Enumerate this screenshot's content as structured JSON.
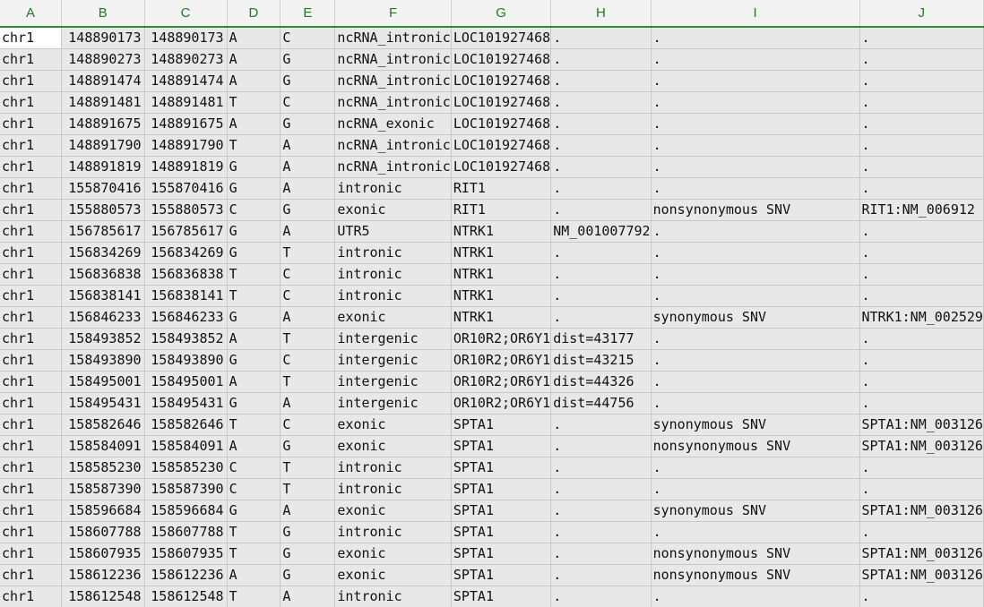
{
  "columns": [
    "A",
    "B",
    "C",
    "D",
    "E",
    "F",
    "G",
    "H",
    "I",
    "J"
  ],
  "rows": [
    [
      "chr1",
      "148890173",
      "148890173",
      "A",
      "C",
      "ncRNA_intronic",
      "LOC101927468",
      ".",
      ".",
      "."
    ],
    [
      "chr1",
      "148890273",
      "148890273",
      "A",
      "G",
      "ncRNA_intronic",
      "LOC101927468",
      ".",
      ".",
      "."
    ],
    [
      "chr1",
      "148891474",
      "148891474",
      "A",
      "G",
      "ncRNA_intronic",
      "LOC101927468",
      ".",
      ".",
      "."
    ],
    [
      "chr1",
      "148891481",
      "148891481",
      "T",
      "C",
      "ncRNA_intronic",
      "LOC101927468",
      ".",
      ".",
      "."
    ],
    [
      "chr1",
      "148891675",
      "148891675",
      "A",
      "G",
      "ncRNA_exonic",
      "LOC101927468",
      ".",
      ".",
      "."
    ],
    [
      "chr1",
      "148891790",
      "148891790",
      "T",
      "A",
      "ncRNA_intronic",
      "LOC101927468",
      ".",
      ".",
      "."
    ],
    [
      "chr1",
      "148891819",
      "148891819",
      "G",
      "A",
      "ncRNA_intronic",
      "LOC101927468",
      ".",
      ".",
      "."
    ],
    [
      "chr1",
      "155870416",
      "155870416",
      "G",
      "A",
      "intronic",
      "RIT1",
      ".",
      ".",
      "."
    ],
    [
      "chr1",
      "155880573",
      "155880573",
      "C",
      "G",
      "exonic",
      "RIT1",
      ".",
      "nonsynonymous SNV",
      "RIT1:NM_006912"
    ],
    [
      "chr1",
      "156785617",
      "156785617",
      "G",
      "A",
      "UTR5",
      "NTRK1",
      "NM_001007792",
      ".",
      "."
    ],
    [
      "chr1",
      "156834269",
      "156834269",
      "G",
      "T",
      "intronic",
      "NTRK1",
      ".",
      ".",
      "."
    ],
    [
      "chr1",
      "156836838",
      "156836838",
      "T",
      "C",
      "intronic",
      "NTRK1",
      ".",
      ".",
      "."
    ],
    [
      "chr1",
      "156838141",
      "156838141",
      "T",
      "C",
      "intronic",
      "NTRK1",
      ".",
      ".",
      "."
    ],
    [
      "chr1",
      "156846233",
      "156846233",
      "G",
      "A",
      "exonic",
      "NTRK1",
      ".",
      "synonymous SNV",
      "NTRK1:NM_002529"
    ],
    [
      "chr1",
      "158493852",
      "158493852",
      "A",
      "T",
      "intergenic",
      "OR10R2;OR6Y1",
      "dist=43177",
      ".",
      "."
    ],
    [
      "chr1",
      "158493890",
      "158493890",
      "G",
      "C",
      "intergenic",
      "OR10R2;OR6Y1",
      "dist=43215",
      ".",
      "."
    ],
    [
      "chr1",
      "158495001",
      "158495001",
      "A",
      "T",
      "intergenic",
      "OR10R2;OR6Y1",
      "dist=44326",
      ".",
      "."
    ],
    [
      "chr1",
      "158495431",
      "158495431",
      "G",
      "A",
      "intergenic",
      "OR10R2;OR6Y1",
      "dist=44756",
      ".",
      "."
    ],
    [
      "chr1",
      "158582646",
      "158582646",
      "T",
      "C",
      "exonic",
      "SPTA1",
      ".",
      "synonymous SNV",
      "SPTA1:NM_003126"
    ],
    [
      "chr1",
      "158584091",
      "158584091",
      "A",
      "G",
      "exonic",
      "SPTA1",
      ".",
      "nonsynonymous SNV",
      "SPTA1:NM_003126"
    ],
    [
      "chr1",
      "158585230",
      "158585230",
      "C",
      "T",
      "intronic",
      "SPTA1",
      ".",
      ".",
      "."
    ],
    [
      "chr1",
      "158587390",
      "158587390",
      "C",
      "T",
      "intronic",
      "SPTA1",
      ".",
      ".",
      "."
    ],
    [
      "chr1",
      "158596684",
      "158596684",
      "G",
      "A",
      "exonic",
      "SPTA1",
      ".",
      "synonymous SNV",
      "SPTA1:NM_003126"
    ],
    [
      "chr1",
      "158607788",
      "158607788",
      "T",
      "G",
      "intronic",
      "SPTA1",
      ".",
      ".",
      "."
    ],
    [
      "chr1",
      "158607935",
      "158607935",
      "T",
      "G",
      "exonic",
      "SPTA1",
      ".",
      "nonsynonymous SNV",
      "SPTA1:NM_003126"
    ],
    [
      "chr1",
      "158612236",
      "158612236",
      "A",
      "G",
      "exonic",
      "SPTA1",
      ".",
      "nonsynonymous SNV",
      "SPTA1:NM_003126"
    ],
    [
      "chr1",
      "158612548",
      "158612548",
      "T",
      "A",
      "intronic",
      "SPTA1",
      ".",
      ".",
      "."
    ]
  ],
  "active_cell": {
    "row": 0,
    "col": 0
  }
}
